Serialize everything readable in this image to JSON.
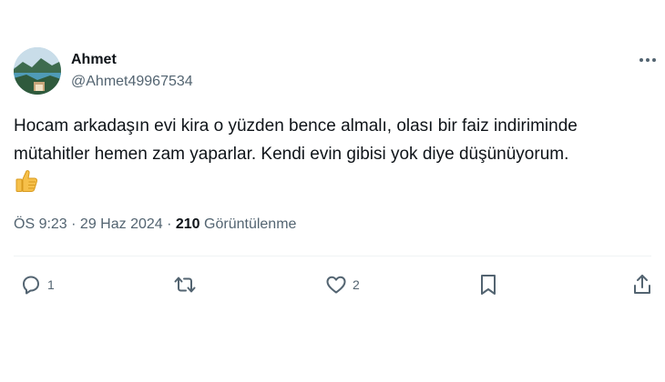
{
  "author": {
    "name": "Ahmet",
    "handle": "@Ahmet49967534",
    "avatar_icon": "landscape-avatar-icon"
  },
  "tweet": {
    "line1": "Hocam arkadaşın evi kira o yüzden bence almalı, olası bir faiz indiriminde",
    "line2": "mütahitler hemen zam yaparlar. Kendi evin gibisi yok diye düşünüyorum.",
    "emoji_icon": "thumbs-up-icon"
  },
  "meta": {
    "time": "ÖS 9:23",
    "separator1": " · ",
    "date": "29 Haz 2024",
    "separator2": " · ",
    "views_count": "210",
    "views_label": " Görüntülenme"
  },
  "actions": {
    "reply": {
      "icon": "reply-icon",
      "count": "1"
    },
    "retweet": {
      "icon": "retweet-icon",
      "count": ""
    },
    "like": {
      "icon": "heart-icon",
      "count": "2"
    },
    "bookmark": {
      "icon": "bookmark-icon",
      "count": ""
    },
    "share": {
      "icon": "share-icon",
      "count": ""
    }
  },
  "colors": {
    "text_primary": "#0f1419",
    "text_secondary": "#536471",
    "divider": "#eff3f4"
  }
}
